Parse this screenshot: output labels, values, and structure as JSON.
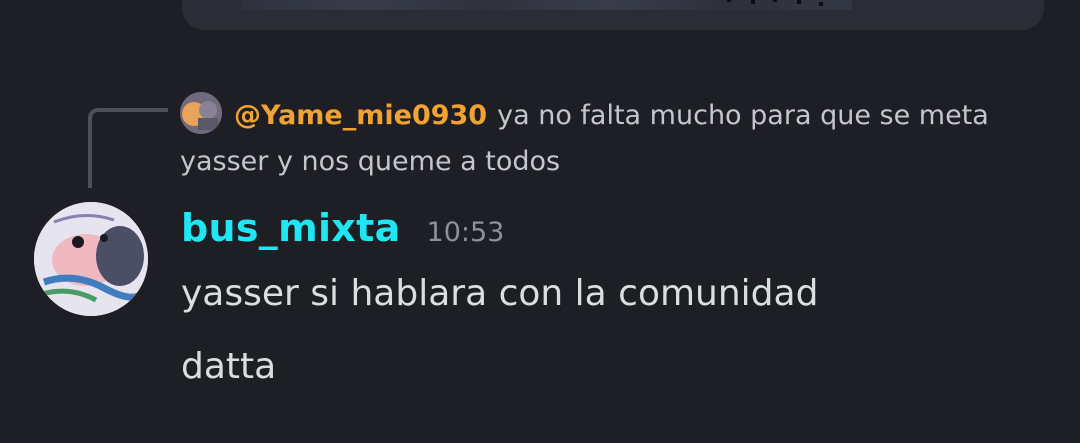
{
  "previous_embed": {},
  "reply": {
    "mention": "@Yame_mie0930",
    "text": "ya no falta mucho para que se meta yasser y nos queme a todos",
    "mention_color": "#f0a232"
  },
  "message": {
    "author": "bus_mixta",
    "author_color": "#1fe6f2",
    "timestamp": "10:53",
    "lines": [
      "yasser si hablara con la comunidad",
      "datta"
    ]
  },
  "icons": {
    "reply_avatar": "user-avatar-icon",
    "author_avatar": "user-avatar-icon"
  }
}
